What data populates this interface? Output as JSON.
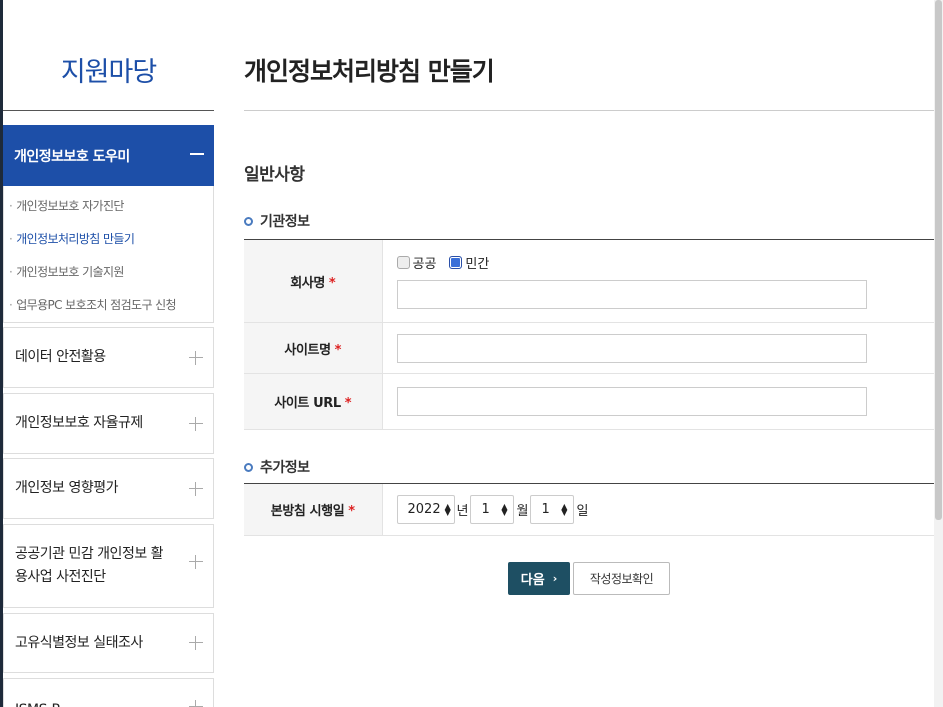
{
  "sidebar": {
    "title": "지원마당",
    "active_menu": "개인정보보호 도우미",
    "sub_items": [
      {
        "label": "개인정보보호 자가진단"
      },
      {
        "label": "개인정보처리방침 만들기"
      },
      {
        "label": "개인정보보호 기술지원"
      },
      {
        "label": "업무용PC 보호조치 점검도구 신청"
      }
    ],
    "menus": [
      {
        "label": "데이터 안전활용"
      },
      {
        "label": "개인정보보호 자율규제"
      },
      {
        "label": "개인정보 영향평가"
      },
      {
        "label": "공공기관 민감 개인정보 활용사업 사전진단"
      },
      {
        "label": "고유식별정보 실태조사"
      },
      {
        "label": "ISMS-P"
      }
    ]
  },
  "main": {
    "page_title": "개인정보처리방침 만들기",
    "section_title": "일반사항",
    "basic_info": {
      "heading": "기관정보",
      "company_label": "회사명",
      "type_options": [
        "공공",
        "민간"
      ],
      "type_selected": "민간",
      "company_value": "",
      "site_name_label": "사이트명",
      "site_name_value": "",
      "site_url_label": "사이트 URL",
      "site_url_value": ""
    },
    "extra_info": {
      "heading": "추가정보",
      "effective_date_label": "본방침 시행일",
      "year": "2022",
      "year_unit": "년",
      "month": "1",
      "month_unit": "월",
      "day": "1",
      "day_unit": "일"
    },
    "required_mark": "*",
    "buttons": {
      "next": "다음",
      "preview": "작성정보확인"
    }
  }
}
